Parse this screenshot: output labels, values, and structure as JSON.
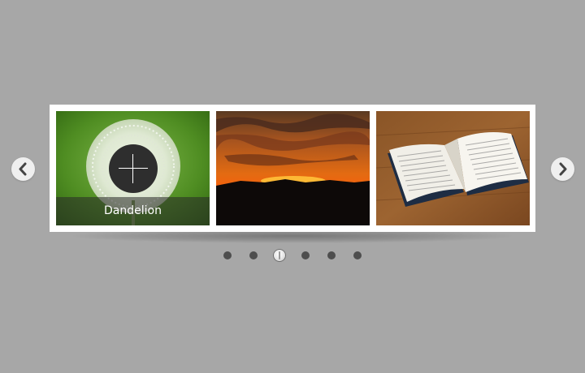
{
  "carousel": {
    "slides": [
      {
        "image": "dandelion-photo",
        "caption": "Dandelion"
      },
      {
        "image": "sunset-photo"
      },
      {
        "image": "open-book-photo"
      }
    ],
    "zoom_icon": "plus-icon",
    "prev_icon": "chevron-left-icon",
    "next_icon": "chevron-right-icon"
  },
  "pagination": {
    "total": 6,
    "active_index": 2
  },
  "colors": {
    "background": "#a7a7a7",
    "frame": "#ffffff",
    "dot": "#4e4e4e",
    "zoom_button": "#2e2e2e"
  }
}
